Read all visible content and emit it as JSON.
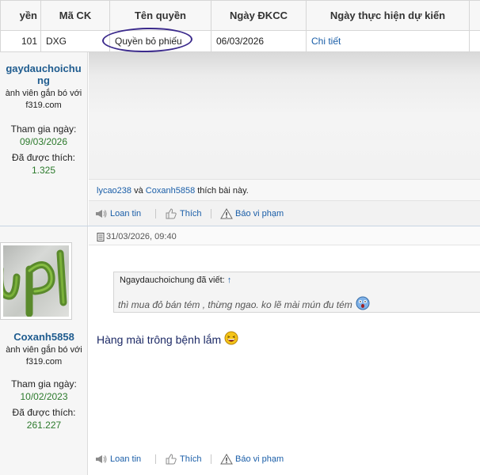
{
  "table": {
    "headers": [
      "yền",
      "Mã CK",
      "Tên quyền",
      "Ngày ĐKCC",
      "Ngày thực hiện dự kiến"
    ],
    "row": [
      "101",
      "DXG",
      "Quyền bỏ phiếu",
      "06/03/2026",
      "Chi tiết"
    ]
  },
  "post1": {
    "username_line1": "gaydauchoichu",
    "username_line2": "ng",
    "usertitle_line1": "ành viên gắn bó với",
    "usertitle_line2": "f319.com",
    "joined_label": "Tham gia ngày:",
    "joined_value": "09/03/2026",
    "likes_label": "Đã được thích:",
    "likes_value": "1.325",
    "liked_by_1": "lycao238",
    "liked_by_and": "và",
    "liked_by_2": "Coxanh5858",
    "liked_suffix": "thích bài này."
  },
  "post2": {
    "username": "Coxanh5858",
    "usertitle_line1": "ành viên gắn bó với",
    "usertitle_line2": "f319.com",
    "joined_label": "Tham gia ngày:",
    "joined_value": "10/02/2023",
    "likes_label": "Đã được thích:",
    "likes_value": "261.227",
    "date": "31/03/2026, 09:40",
    "quote_author": "Ngaydauchoichung đã viết:",
    "quote_arrow": "↑",
    "quote_text": "thì mua đỏ bán tém , thừng ngao. ko lẽ mài mún đu tém",
    "message": "Hàng mài trông bệnh lắm"
  },
  "actions": {
    "share": "Loan tin",
    "like": "Thích",
    "report": "Báo vi phạm"
  },
  "colors": {
    "link": "#1a5ea8",
    "username": "#1f5c8f",
    "stat_value": "#2c7a2c",
    "circle": "#3b2a8c"
  }
}
